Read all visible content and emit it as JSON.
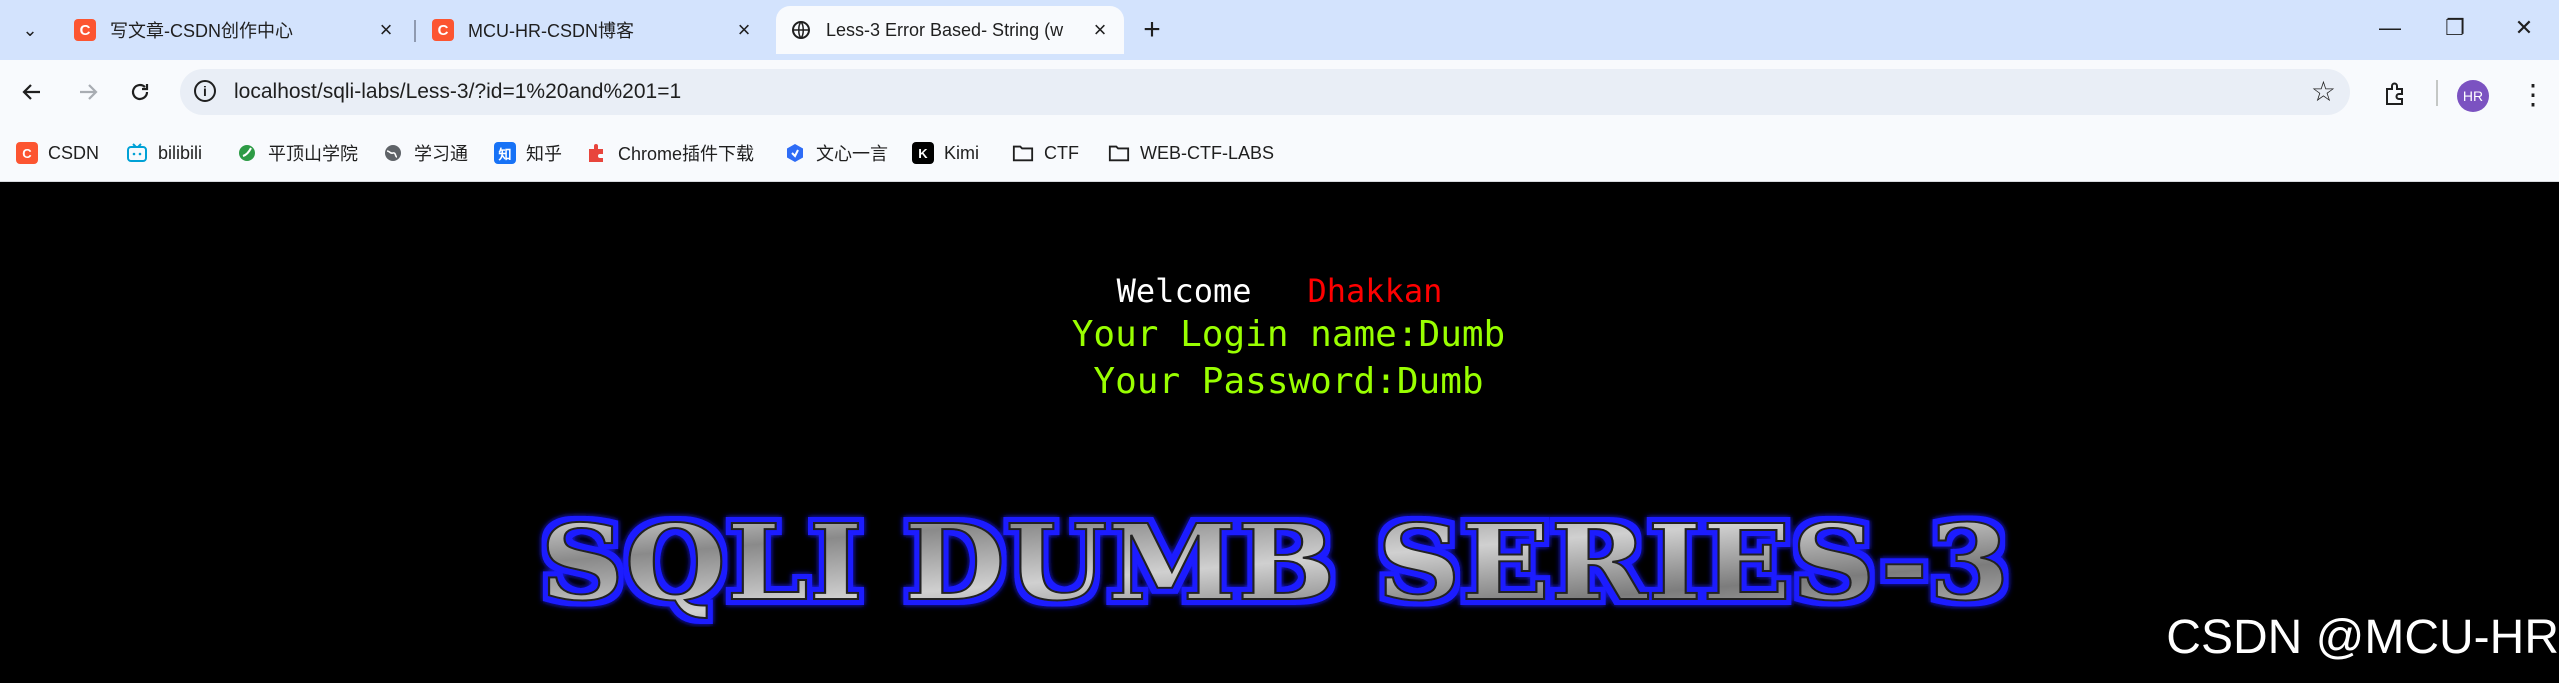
{
  "browser": {
    "tabs": [
      {
        "title": "写文章-CSDN创作中心",
        "favicon": "C",
        "active": false
      },
      {
        "title": "MCU-HR-CSDN博客",
        "favicon": "C",
        "active": false
      },
      {
        "title": "Less-3 Error Based- String (w",
        "favicon": "globe-icon",
        "active": true
      }
    ],
    "new_tab": "+",
    "window": {
      "minimize": "—",
      "restore": "❐",
      "close": "✕"
    },
    "address": {
      "url": "localhost/sqli-labs/Less-3/?id=1%20and%201=1"
    },
    "avatar": "HR",
    "bookmarks": [
      {
        "label": "CSDN",
        "icon": "C",
        "color": "#fc5531"
      },
      {
        "label": "bilibili",
        "icon": "tv",
        "color": "#00a1d6"
      },
      {
        "label": "平顶山学院",
        "icon": "leaf",
        "color": "#2d9b45"
      },
      {
        "label": "学习通",
        "icon": "globe",
        "color": "#5f6368"
      },
      {
        "label": "知乎",
        "icon": "知",
        "color": "#1772f6"
      },
      {
        "label": "Chrome插件下载",
        "icon": "puzzle",
        "color": "#e8453c"
      },
      {
        "label": "文心一言",
        "icon": "hex",
        "color": "#2e6cf6"
      },
      {
        "label": "Kimi",
        "icon": "K",
        "color": "#000000"
      },
      {
        "label": "CTF",
        "icon": "folder",
        "color": "#1f1f1f"
      },
      {
        "label": "WEB-CTF-LABS",
        "icon": "folder",
        "color": "#1f1f1f"
      }
    ]
  },
  "page": {
    "welcome": "Welcome",
    "name": "Dhakkan",
    "login": "Your Login name:Dumb",
    "password": "Your Password:Dumb",
    "banner": "SQLI DUMB SERIES-3",
    "watermark": "CSDN @MCU-HR"
  },
  "colors": {
    "welcome": "#ffffff",
    "name": "#ff0000",
    "info": "#99ff00",
    "banner_glow": "#1a1aff"
  }
}
